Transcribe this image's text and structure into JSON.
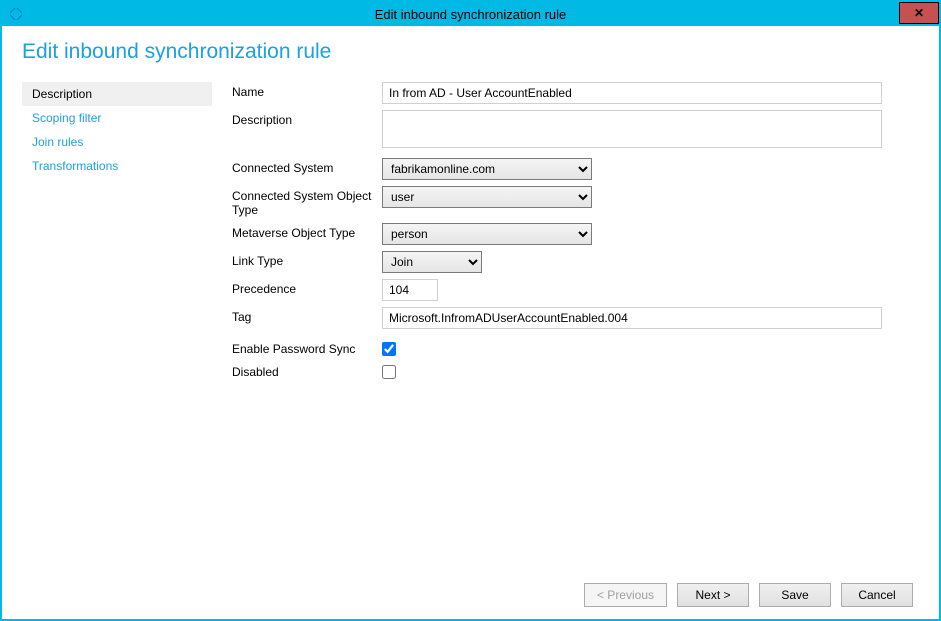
{
  "window": {
    "title": "Edit inbound synchronization rule"
  },
  "page": {
    "heading": "Edit inbound synchronization rule"
  },
  "sidebar": {
    "items": [
      {
        "label": "Description",
        "selected": true
      },
      {
        "label": "Scoping filter",
        "selected": false
      },
      {
        "label": "Join rules",
        "selected": false
      },
      {
        "label": "Transformations",
        "selected": false
      }
    ]
  },
  "form": {
    "name_label": "Name",
    "name_value": "In from AD - User AccountEnabled",
    "description_label": "Description",
    "description_value": "",
    "connected_system_label": "Connected System",
    "connected_system_value": "fabrikamonline.com",
    "cs_object_type_label": "Connected System Object Type",
    "cs_object_type_value": "user",
    "mv_object_type_label": "Metaverse Object Type",
    "mv_object_type_value": "person",
    "link_type_label": "Link Type",
    "link_type_value": "Join",
    "precedence_label": "Precedence",
    "precedence_value": "104",
    "tag_label": "Tag",
    "tag_value": "Microsoft.InfromADUserAccountEnabled.004",
    "enable_password_sync_label": "Enable Password Sync",
    "enable_password_sync_checked": true,
    "disabled_label": "Disabled",
    "disabled_checked": false
  },
  "footer": {
    "previous_label": "< Previous",
    "next_label": "Next >",
    "save_label": "Save",
    "cancel_label": "Cancel"
  }
}
